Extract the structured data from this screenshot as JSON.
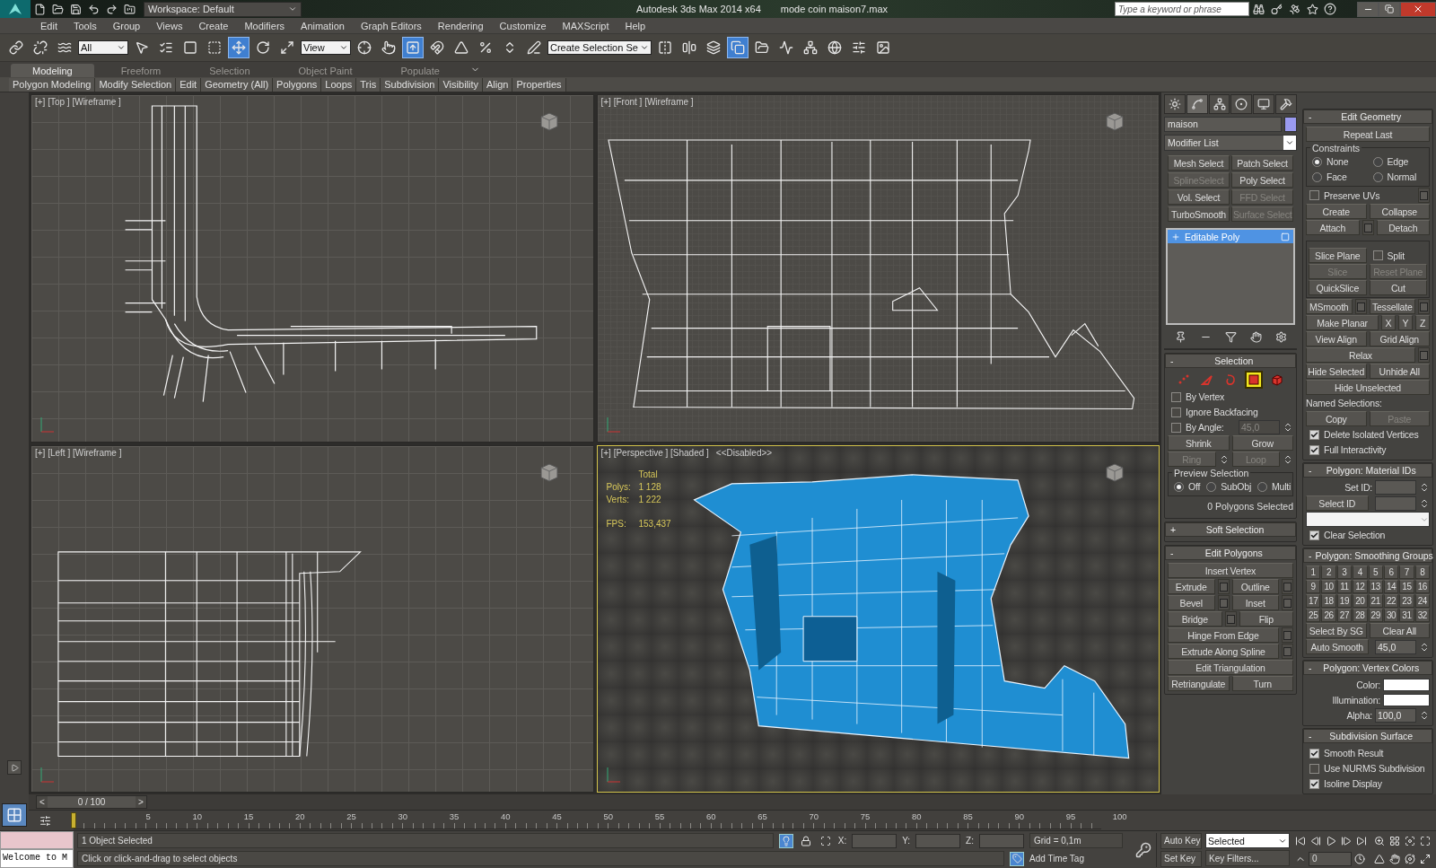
{
  "title_bar": {
    "workspace": "Workspace: Default",
    "app_title": "Autodesk 3ds Max  2014 x64",
    "file_name": "mode coin maison7.max",
    "search": {
      "placeholder": "Type a keyword or phrase"
    }
  },
  "menu": [
    "Edit",
    "Tools",
    "Group",
    "Views",
    "Create",
    "Modifiers",
    "Animation",
    "Graph Editors",
    "Rendering",
    "Customize",
    "MAXScript",
    "Help"
  ],
  "toolbar": [
    {
      "kind": "tool",
      "active": false
    },
    {
      "kind": "tool",
      "active": false
    },
    {
      "kind": "tool",
      "active": false
    },
    {
      "kind": "dropdown",
      "value": "All"
    },
    {
      "kind": "tool",
      "active": false
    },
    {
      "kind": "tool",
      "active": false
    },
    {
      "kind": "tool",
      "active": false
    },
    {
      "kind": "tool",
      "active": false
    },
    {
      "kind": "tool",
      "active": true
    },
    {
      "kind": "tool",
      "active": false
    },
    {
      "kind": "tool",
      "active": false
    },
    {
      "kind": "dropdown",
      "value": "View"
    },
    {
      "kind": "tool",
      "active": false
    },
    {
      "kind": "tool",
      "active": false
    },
    {
      "kind": "tool",
      "active": true
    },
    {
      "kind": "tool",
      "active": false
    },
    {
      "kind": "tool",
      "active": false
    },
    {
      "kind": "tool",
      "active": false
    },
    {
      "kind": "tool",
      "active": false
    },
    {
      "kind": "tool",
      "active": false
    },
    {
      "kind": "dropdown",
      "value": "Create Selection Se"
    },
    {
      "kind": "tool",
      "active": false
    },
    {
      "kind": "tool",
      "active": false
    },
    {
      "kind": "tool",
      "active": false
    },
    {
      "kind": "tool",
      "active": true
    },
    {
      "kind": "tool",
      "active": false
    },
    {
      "kind": "tool",
      "active": false
    },
    {
      "kind": "tool",
      "active": false
    },
    {
      "kind": "tool",
      "active": false
    },
    {
      "kind": "tool",
      "active": false
    },
    {
      "kind": "tool",
      "active": false
    }
  ],
  "ribbon": {
    "tabs": [
      {
        "label": "Modeling",
        "selected": true
      },
      {
        "label": "Freeform",
        "selected": false
      },
      {
        "label": "Selection",
        "selected": false
      },
      {
        "label": "Object Paint",
        "selected": false
      },
      {
        "label": "Populate",
        "selected": false
      }
    ],
    "panels": [
      "Polygon Modeling",
      "Modify Selection",
      "Edit",
      "Geometry (All)",
      "Polygons",
      "Loops",
      "Tris",
      "Subdivision",
      "Visibility",
      "Align",
      "Properties"
    ]
  },
  "viewports": [
    {
      "kind": "top",
      "label": "[+] [Top ] [Wireframe ]",
      "active": false
    },
    {
      "kind": "front",
      "label": "[+] [Front ] [Wireframe ]",
      "active": false
    },
    {
      "kind": "left",
      "label": "[+] [Left ] [Wireframe ]",
      "active": false
    },
    {
      "kind": "perspective",
      "label": "[+] [Perspective ] [Shaded ]",
      "note": "<<Disabled>>",
      "active": true,
      "stats": {
        "header": "Total",
        "rows": [
          {
            "label": "Polys:",
            "value": "1 128"
          },
          {
            "label": "Verts:",
            "value": "1 222"
          }
        ],
        "fps_label": "FPS:",
        "fps": "153,437"
      }
    }
  ],
  "command_panel": {
    "tabs": [
      {
        "selected": false
      },
      {
        "selected": true
      },
      {
        "selected": false
      },
      {
        "selected": false
      },
      {
        "selected": false
      },
      {
        "selected": false
      }
    ],
    "object_name": "maison",
    "modifier_list": "Modifier List",
    "modifier_buttons": [
      {
        "label": "Mesh Select",
        "disabled": false
      },
      {
        "label": "Patch Select",
        "disabled": false
      },
      {
        "label": "SplineSelect",
        "disabled": true
      },
      {
        "label": "Poly Select",
        "disabled": false
      },
      {
        "label": "Vol. Select",
        "disabled": false
      },
      {
        "label": "FFD Select",
        "disabled": true
      },
      {
        "label": "TurboSmooth",
        "disabled": false
      },
      {
        "label": "Surface Select",
        "disabled": true
      }
    ],
    "stack": [
      {
        "label": "Editable Poly",
        "selected": true
      }
    ],
    "left_rollouts": [
      {
        "sign": "-",
        "title": "Selection",
        "rows": [
          [
            {
              "kind": "levels",
              "levels": [
                {
                  "selected": false
                },
                {
                  "selected": false
                },
                {
                  "selected": false
                },
                {
                  "selected": true
                },
                {
                  "selected": false
                }
              ]
            }
          ],
          [
            {
              "kind": "check",
              "label": "By Vertex",
              "checked": false
            }
          ],
          [
            {
              "kind": "check",
              "label": "Ignore Backfacing",
              "checked": false
            }
          ],
          [
            {
              "kind": "check",
              "label": "By Angle:",
              "checked": false
            },
            {
              "kind": "spinner",
              "value": "45,0",
              "disabled": true
            }
          ],
          [
            {
              "kind": "button",
              "label": "Shrink",
              "disabled": false,
              "settings": false
            },
            {
              "kind": "button",
              "label": "Grow",
              "disabled": false,
              "settings": false
            }
          ],
          [
            {
              "kind": "spinbutton",
              "label": "Ring",
              "disabled": true
            },
            {
              "kind": "spinbutton",
              "label": "Loop",
              "disabled": true
            }
          ],
          [
            {
              "kind": "group",
              "title": "Preview Selection",
              "rows": [
                [
                  {
                    "kind": "radio",
                    "label": "Off",
                    "selected": true
                  },
                  {
                    "kind": "radio",
                    "label": "SubObj",
                    "selected": false
                  },
                  {
                    "kind": "radio",
                    "label": "Multi",
                    "selected": false
                  }
                ]
              ]
            }
          ],
          [
            {
              "kind": "note",
              "label": "0 Polygons Selected"
            }
          ]
        ]
      },
      {
        "sign": "+",
        "title": "Soft Selection"
      },
      {
        "sign": "-",
        "title": "Edit Polygons",
        "rows": [
          [
            {
              "kind": "button",
              "label": "Insert Vertex",
              "disabled": false,
              "settings": false
            }
          ],
          [
            {
              "kind": "button",
              "label": "Extrude",
              "disabled": false,
              "settings": true
            },
            {
              "kind": "button",
              "label": "Outline",
              "disabled": false,
              "settings": true
            }
          ],
          [
            {
              "kind": "button",
              "label": "Bevel",
              "disabled": false,
              "settings": true
            },
            {
              "kind": "button",
              "label": "Inset",
              "disabled": false,
              "settings": true
            }
          ],
          [
            {
              "kind": "button",
              "label": "Bridge",
              "disabled": false,
              "settings": true
            },
            {
              "kind": "button",
              "label": "Flip",
              "disabled": false,
              "settings": false
            }
          ],
          [
            {
              "kind": "button",
              "label": "Hinge From Edge",
              "disabled": false,
              "settings": true
            }
          ],
          [
            {
              "kind": "button",
              "label": "Extrude Along Spline",
              "disabled": false,
              "settings": true
            }
          ],
          [
            {
              "kind": "button",
              "label": "Edit Triangulation",
              "disabled": false,
              "settings": false
            }
          ],
          [
            {
              "kind": "button",
              "label": "Retriangulate",
              "disabled": false,
              "settings": false
            },
            {
              "kind": "button",
              "label": "Turn",
              "disabled": false,
              "settings": false
            }
          ]
        ]
      }
    ],
    "right_rollouts": [
      {
        "sign": "-",
        "title": "Edit Geometry",
        "rows": [
          [
            {
              "kind": "button",
              "label": "Repeat Last",
              "disabled": false,
              "settings": false
            }
          ],
          [
            {
              "kind": "group",
              "title": "Constraints",
              "rows": [
                [
                  {
                    "kind": "radio",
                    "label": "None",
                    "selected": true
                  },
                  {
                    "kind": "radio",
                    "label": "Edge",
                    "selected": false
                  }
                ],
                [
                  {
                    "kind": "radio",
                    "label": "Face",
                    "selected": false
                  },
                  {
                    "kind": "radio",
                    "label": "Normal",
                    "selected": false
                  }
                ]
              ]
            }
          ],
          [
            {
              "kind": "check",
              "label": "Preserve UVs",
              "checked": false
            },
            {
              "kind": "settings"
            }
          ],
          [
            {
              "kind": "button",
              "label": "Create",
              "disabled": false,
              "settings": false
            },
            {
              "kind": "button",
              "label": "Collapse",
              "disabled": false,
              "settings": false
            }
          ],
          [
            {
              "kind": "button",
              "label": "Attach",
              "disabled": false,
              "settings": true
            },
            {
              "kind": "button",
              "label": "Detach",
              "disabled": false,
              "settings": false
            }
          ],
          [
            {
              "kind": "group",
              "rows": [
                [
                  {
                    "kind": "button",
                    "label": "Slice Plane",
                    "disabled": false,
                    "settings": false
                  },
                  {
                    "kind": "check",
                    "label": "Split",
                    "checked": false
                  }
                ],
                [
                  {
                    "kind": "button",
                    "label": "Slice",
                    "disabled": true,
                    "settings": false
                  },
                  {
                    "kind": "button",
                    "label": "Reset Plane",
                    "disabled": true,
                    "settings": false
                  }
                ],
                [
                  {
                    "kind": "button",
                    "label": "QuickSlice",
                    "disabled": false,
                    "settings": false
                  },
                  {
                    "kind": "button",
                    "label": "Cut",
                    "disabled": false,
                    "settings": false
                  }
                ]
              ]
            }
          ],
          [
            {
              "kind": "button",
              "label": "MSmooth",
              "disabled": false,
              "settings": true
            },
            {
              "kind": "button",
              "label": "Tessellate",
              "disabled": false,
              "settings": true
            }
          ],
          [
            {
              "kind": "button",
              "label": "Make Planar",
              "disabled": false,
              "settings": false
            },
            {
              "kind": "mini",
              "label": "X"
            },
            {
              "kind": "mini",
              "label": "Y"
            },
            {
              "kind": "mini",
              "label": "Z"
            }
          ],
          [
            {
              "kind": "button",
              "label": "View Align",
              "disabled": false,
              "settings": false
            },
            {
              "kind": "button",
              "label": "Grid Align",
              "disabled": false,
              "settings": false
            }
          ],
          [
            {
              "kind": "button",
              "label": "Relax",
              "disabled": false,
              "settings": true
            }
          ],
          [
            {
              "kind": "button",
              "label": "Hide Selected",
              "disabled": false,
              "settings": false
            },
            {
              "kind": "button",
              "label": "Unhide All",
              "disabled": false,
              "settings": false
            }
          ],
          [
            {
              "kind": "button",
              "label": "Hide Unselected",
              "disabled": false,
              "settings": false
            }
          ],
          [
            {
              "kind": "label",
              "label": "Named Selections:"
            }
          ],
          [
            {
              "kind": "button",
              "label": "Copy",
              "disabled": false,
              "settings": false
            },
            {
              "kind": "button",
              "label": "Paste",
              "disabled": true,
              "settings": false
            }
          ],
          [
            {
              "kind": "check",
              "label": "Delete Isolated Vertices",
              "checked": true
            }
          ],
          [
            {
              "kind": "check",
              "label": "Full Interactivity",
              "checked": true
            }
          ]
        ]
      },
      {
        "sign": "-",
        "title": "Polygon: Material IDs",
        "rows": [
          [
            {
              "kind": "spinner",
              "label": "Set ID:",
              "disabled": false
            }
          ],
          [
            {
              "kind": "button",
              "label": "Select ID",
              "disabled": false,
              "settings": false
            },
            {
              "kind": "spinner",
              "disabled": false
            }
          ],
          [
            {
              "kind": "dropdown"
            }
          ],
          [
            {
              "kind": "check",
              "label": "Clear Selection",
              "checked": true
            }
          ]
        ]
      },
      {
        "sign": "-",
        "title": "Polygon: Smoothing Groups",
        "rows": [
          [
            {
              "kind": "numbers",
              "labels": [
                "1",
                "2",
                "3",
                "4",
                "5",
                "6",
                "7",
                "8",
                "9",
                "10",
                "11",
                "12",
                "13",
                "14",
                "15",
                "16",
                "17",
                "18",
                "19",
                "20",
                "21",
                "22",
                "23",
                "24",
                "25",
                "26",
                "27",
                "28",
                "29",
                "30",
                "31",
                "32"
              ]
            }
          ],
          [
            {
              "kind": "button",
              "label": "Select By SG",
              "disabled": false,
              "settings": false
            },
            {
              "kind": "button",
              "label": "Clear All",
              "disabled": false,
              "settings": false
            }
          ],
          [
            {
              "kind": "button",
              "label": "Auto Smooth",
              "disabled": false,
              "settings": false
            },
            {
              "kind": "spinner",
              "value": "45,0",
              "disabled": false
            }
          ]
        ]
      },
      {
        "sign": "-",
        "title": "Polygon: Vertex Colors",
        "rows": [
          [
            {
              "kind": "swatch",
              "label": "Color:"
            }
          ],
          [
            {
              "kind": "swatch",
              "label": "Illumination:"
            }
          ],
          [
            {
              "kind": "spinner",
              "label": "Alpha:",
              "value": "100,0",
              "disabled": false
            }
          ]
        ]
      },
      {
        "sign": "-",
        "title": "Subdivision Surface",
        "rows": [
          [
            {
              "kind": "check",
              "label": "Smooth Result",
              "checked": true
            }
          ],
          [
            {
              "kind": "check",
              "label": "Use NURMS Subdivision",
              "checked": false
            }
          ],
          [
            {
              "kind": "check",
              "label": "Isoline Display",
              "checked": true
            }
          ]
        ]
      }
    ]
  },
  "timeline": {
    "prev": "<",
    "position": "0 / 100",
    "next": ">",
    "level": 0,
    "ticks": [
      "5",
      "10",
      "15",
      "20",
      "25",
      "30",
      "35",
      "40",
      "45",
      "50",
      "55",
      "60",
      "65",
      "70",
      "75",
      "80",
      "85",
      "90",
      "95",
      "100"
    ]
  },
  "status_bar": {
    "listener": "Welcome to M",
    "selection": "1 Object Selected",
    "prompt": "Click or click-and-drag to select objects",
    "coords": [
      "X:",
      "Y:",
      "Z:"
    ],
    "grid": "Grid = 0,1m",
    "time_tag": "Add Time Tag",
    "auto_key": "Auto Key",
    "set_key": "Set Key",
    "key_mode": "Selected",
    "key_filters": "Key Filters...",
    "frame": "0"
  }
}
